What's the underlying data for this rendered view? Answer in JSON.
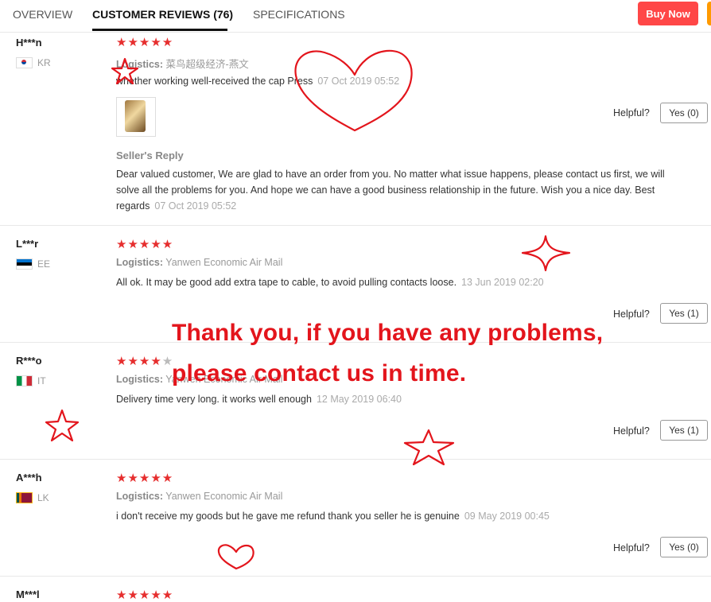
{
  "tabs": {
    "overview": "OVERVIEW",
    "reviews": "CUSTOMER REVIEWS (76)",
    "specs": "SPECIFICATIONS",
    "buy": "Buy Now"
  },
  "helpful_label": "Helpful?",
  "logistics_label": "Logistics:",
  "colors": {
    "accent": "#ff4747",
    "star": "#e62e2e",
    "annotation": "#e3151c"
  },
  "reviews": [
    {
      "user": "H***n",
      "country": "KR",
      "rating": 5,
      "logistics": "菜鸟超级经济-燕文",
      "text": "whether working well-received the cap Press",
      "date": "07 Oct 2019 05:52",
      "helpful": "Yes (0)",
      "seller_reply_title": "Seller's Reply",
      "seller_reply": "Dear valued customer, We are glad to have an order from you. No matter what issue happens, please contact us first, we will solve all the problems for you. And hope we can have a good business relationship in the future. Wish you a nice day. Best regards",
      "seller_reply_date": "07 Oct 2019 05:52"
    },
    {
      "user": "L***r",
      "country": "EE",
      "rating": 5,
      "logistics": "Yanwen Economic Air Mail",
      "text": "All ok. It may be good add extra tape to cable, to avoid pulling contacts loose.",
      "date": "13 Jun 2019 02:20",
      "helpful": "Yes (1)"
    },
    {
      "user": "R***o",
      "country": "IT",
      "rating": 4,
      "logistics": "Yanwen Economic Air Mail",
      "text": "Delivery time very long. it works well enough",
      "date": "12 May 2019 06:40",
      "helpful": "Yes (1)"
    },
    {
      "user": "A***h",
      "country": "LK",
      "rating": 5,
      "logistics": "Yanwen Economic Air Mail",
      "text": "i don't receive my goods but he gave me refund thank you seller he is genuine",
      "date": "09 May 2019 00:45",
      "helpful": "Yes (0)"
    },
    {
      "user": "M***l",
      "rating": 5
    }
  ],
  "annotation": {
    "line1": "Thank you, if you have any problems,",
    "line2": "please contact us in time."
  }
}
